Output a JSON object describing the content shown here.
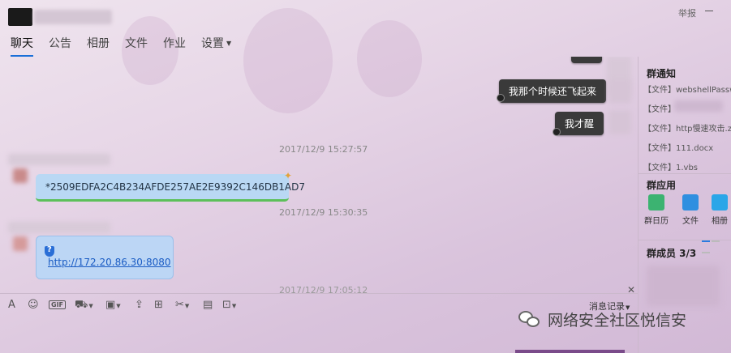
{
  "header": {
    "report_label": "举报"
  },
  "tabs": [
    {
      "label": "聊天",
      "active": true
    },
    {
      "label": "公告"
    },
    {
      "label": "相册"
    },
    {
      "label": "文件"
    },
    {
      "label": "作业"
    },
    {
      "label": "设置"
    }
  ],
  "messages": {
    "outgoing_1": "我那个时候还飞起来",
    "outgoing_2": "我才醒",
    "timestamp_1": "2017/12/9 15:27:57",
    "incoming_hash": "*2509EDFA2C4B234AFDE257AE2E9392C146DB1AD7",
    "timestamp_2": "2017/12/9 15:30:35",
    "incoming_link": "http://172.20.86.30:8080",
    "timestamp_3": "2017/12/9 17:05:12"
  },
  "toolbar": {
    "history_label": "消息记录"
  },
  "right_panel": {
    "notice_title": "群通知",
    "files": [
      "【文件】webshellPassword",
      "【文件】",
      "【文件】http慢速攻击.zip",
      "【文件】111.docx",
      "【文件】1.vbs"
    ],
    "apps_title": "群应用",
    "apps": [
      {
        "label": "群日历",
        "color": "#3cb371"
      },
      {
        "label": "文件",
        "color": "#2f8fe0"
      },
      {
        "label": "相册",
        "color": "#2aa6e8"
      }
    ],
    "members_title": "群成员 3/3"
  },
  "watermark": {
    "text": "网络安全社区悦信安"
  },
  "colors": {
    "accent": "#1a6fd8",
    "bubble_out": "#3a3a3a",
    "bubble_in": "#b9d8f4"
  }
}
